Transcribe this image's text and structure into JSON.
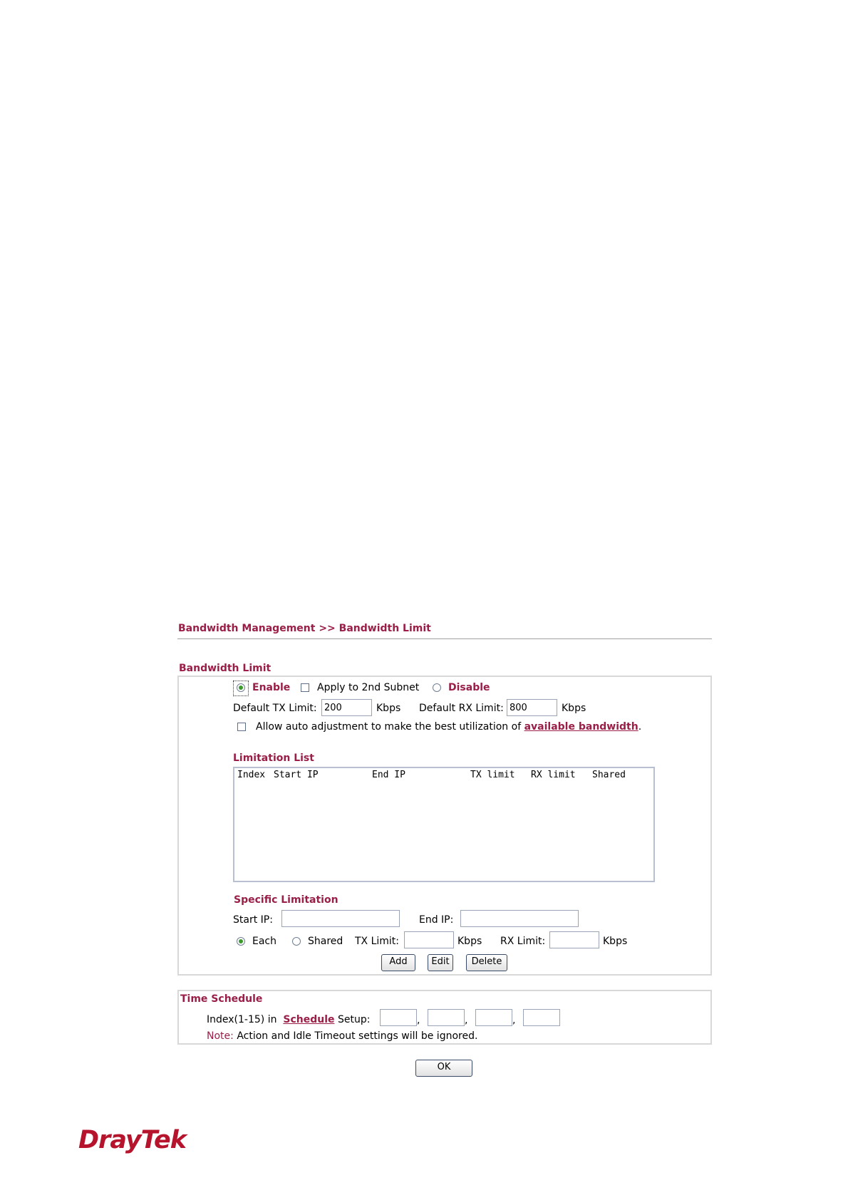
{
  "breadcrumb": "Bandwidth Management >> Bandwidth Limit",
  "bandwidth_limit": {
    "title": "Bandwidth Limit",
    "enable_label": "Enable",
    "enable_selected": true,
    "apply_subnet_label": "Apply to 2nd Subnet",
    "apply_subnet_checked": false,
    "disable_label": "Disable",
    "default_tx_label": "Default TX Limit:",
    "default_tx_value": "200",
    "kbps_label": "Kbps",
    "default_rx_label": "Default RX Limit:",
    "default_rx_value": "800",
    "auto_adjust_text": "Allow auto adjustment to make the best utilization of",
    "auto_adjust_link": "available bandwidth",
    "auto_adjust_period": ".",
    "auto_adjust_checked": false
  },
  "limitation_list": {
    "title": "Limitation List",
    "columns": [
      "Index",
      "Start IP",
      "End IP",
      "TX limit",
      "RX limit",
      "Shared"
    ]
  },
  "specific_limitation": {
    "title": "Specific Limitation",
    "start_ip_label": "Start IP:",
    "start_ip_value": "",
    "end_ip_label": "End IP:",
    "end_ip_value": "",
    "each_label": "Each",
    "each_selected": true,
    "shared_label": "Shared",
    "tx_limit_label": "TX Limit:",
    "tx_limit_value": "",
    "kbps_label": "Kbps",
    "rx_limit_label": "RX Limit:",
    "rx_limit_value": "",
    "add_button": "Add",
    "edit_button": "Edit",
    "delete_button": "Delete"
  },
  "time_schedule": {
    "title": "Time Schedule",
    "index_prefix": "Index(1-15) in",
    "schedule_link": "Schedule",
    "setup_suffix": "Setup:",
    "schedule_values": [
      "",
      "",
      "",
      ""
    ],
    "separator": ",",
    "note_label": "Note:",
    "note_text": "Action and Idle Timeout settings will be ignored."
  },
  "ok_button": "OK",
  "logo_text": "DrayTek"
}
